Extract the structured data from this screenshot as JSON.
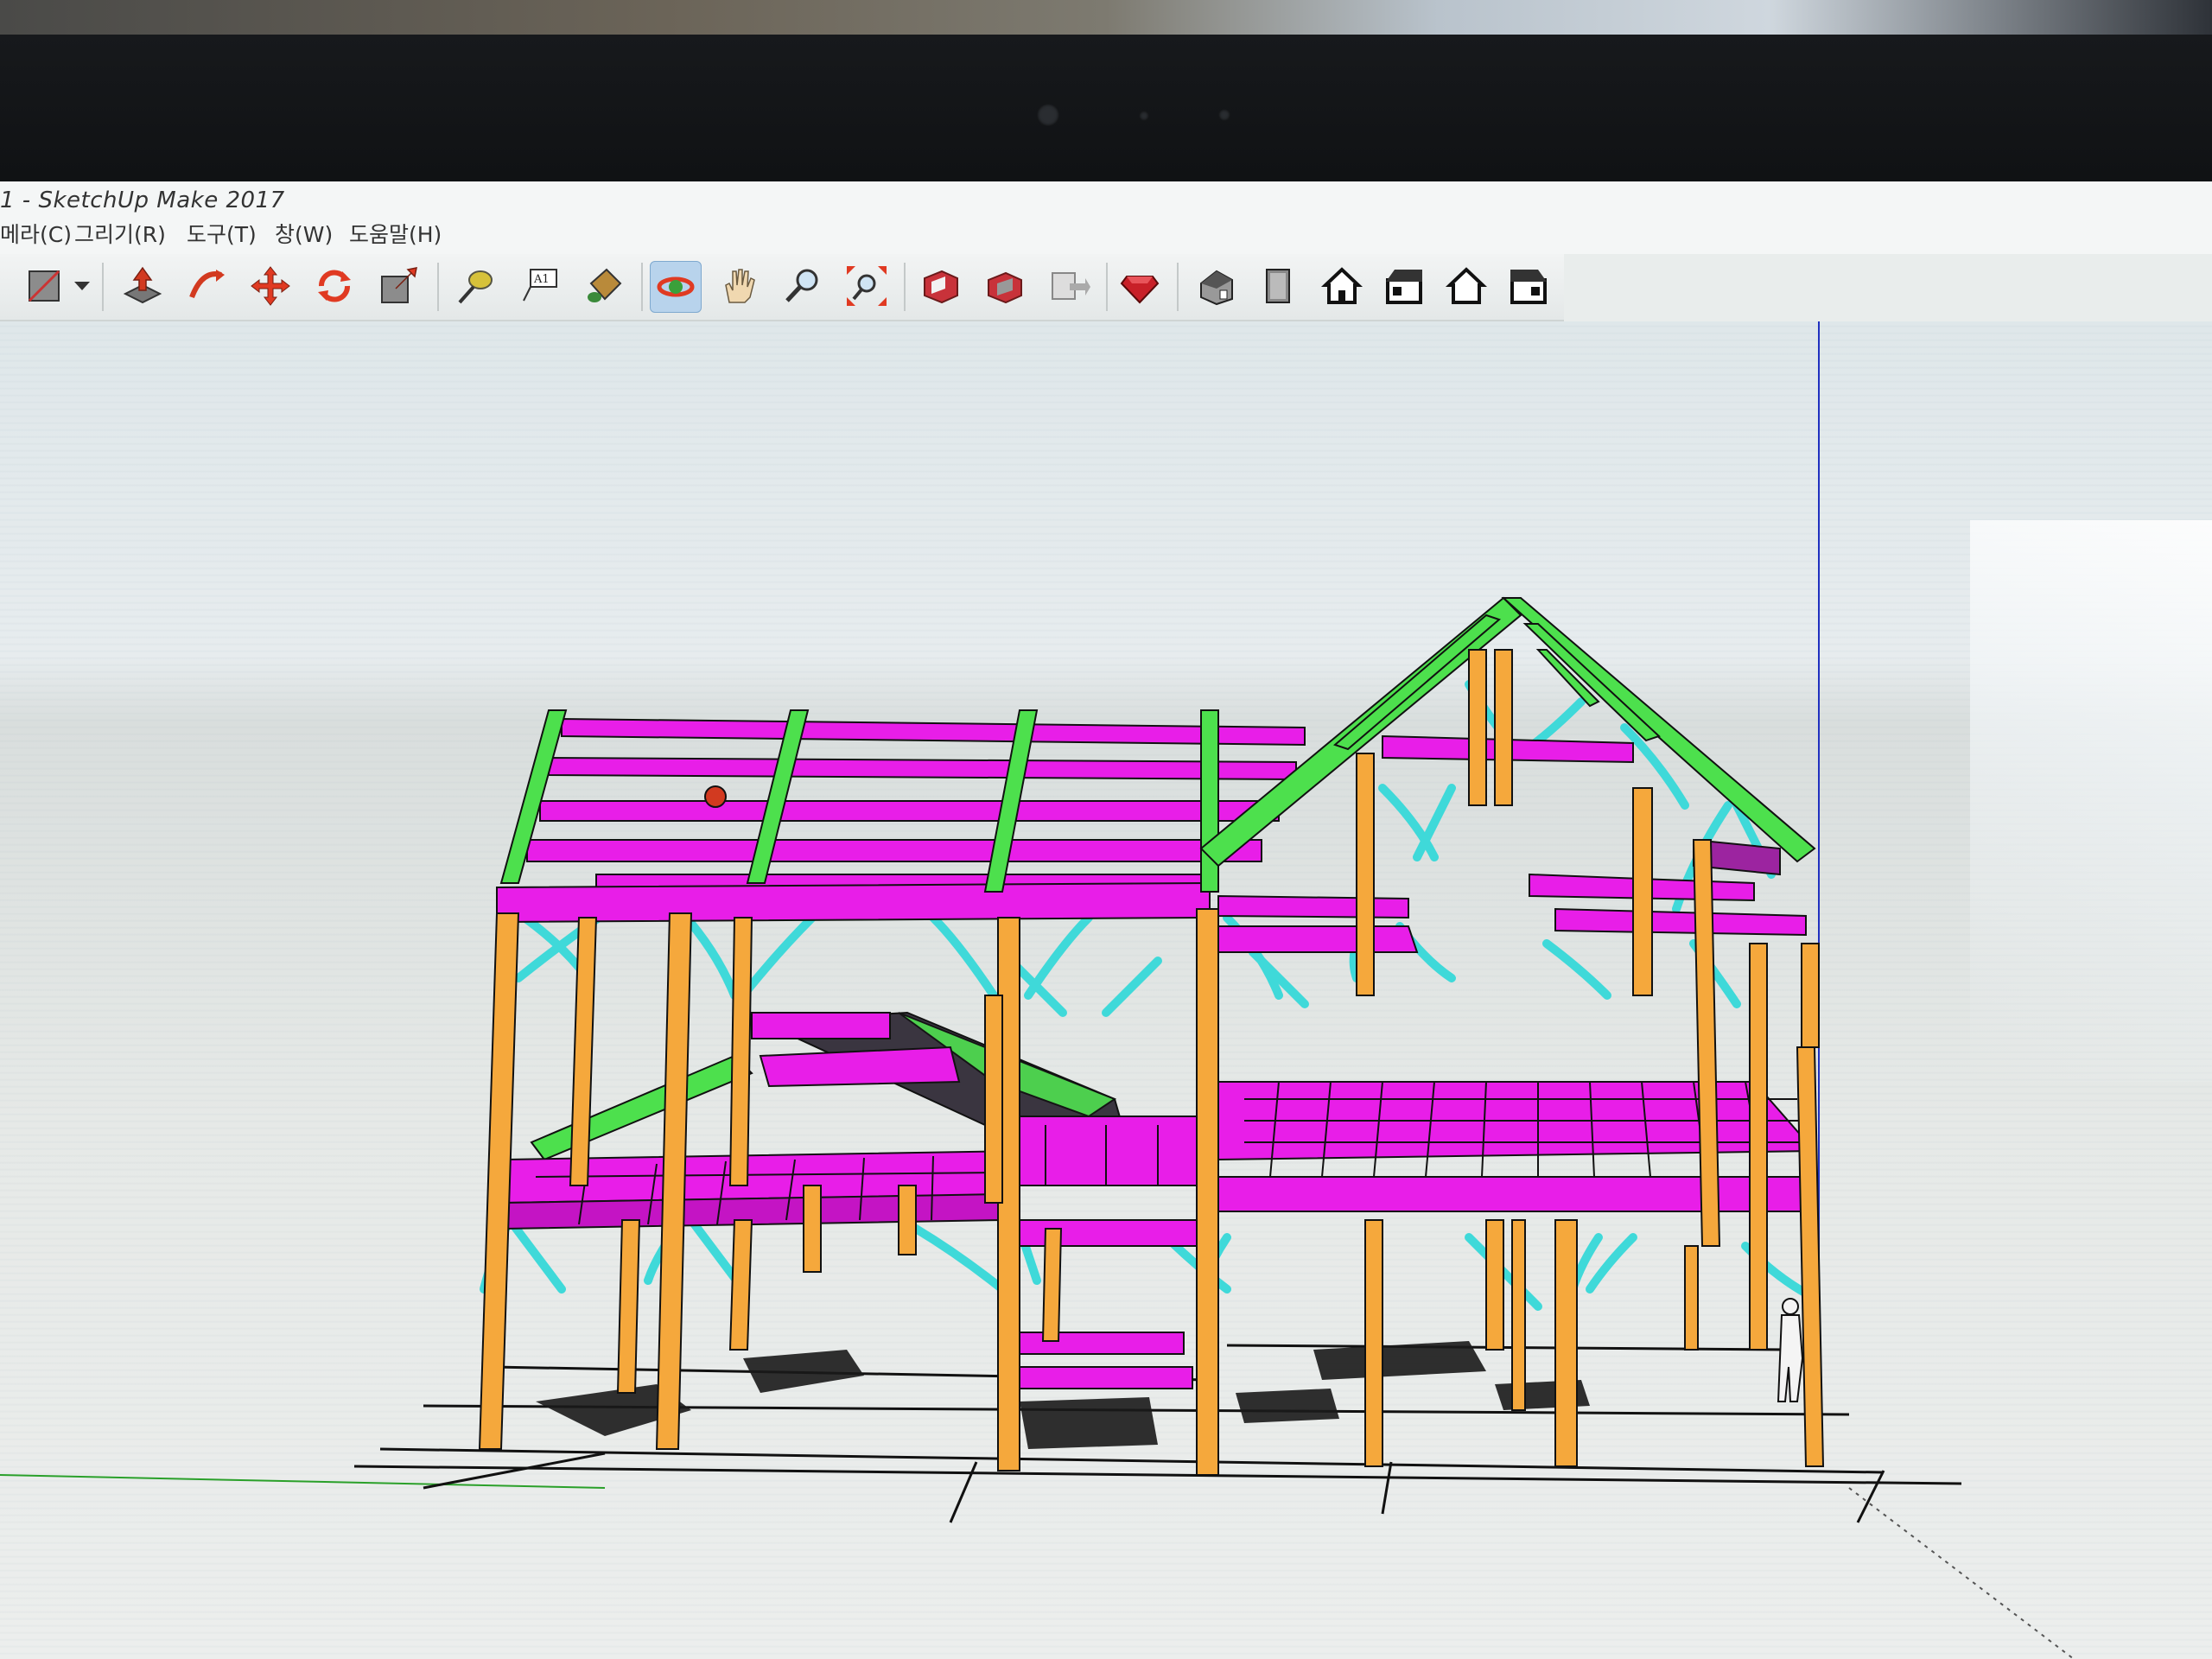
{
  "window": {
    "title": "1 - SketchUp Make 2017"
  },
  "menu": {
    "items": [
      {
        "label": "메라(C)"
      },
      {
        "label": "그리기(R)"
      },
      {
        "label": "도구(T)"
      },
      {
        "label": "창(W)"
      },
      {
        "label": "도움말(H)"
      }
    ]
  },
  "toolbar": {
    "tools": [
      {
        "icon": "rectangle-icon"
      },
      {
        "icon": "dropdown-arrow-icon"
      },
      {
        "icon": "push-pull-icon"
      },
      {
        "icon": "follow-me-icon"
      },
      {
        "icon": "move-icon"
      },
      {
        "icon": "rotate-icon"
      },
      {
        "icon": "scale-icon"
      },
      {
        "icon": "tape-measure-icon"
      },
      {
        "icon": "text-label-icon"
      },
      {
        "icon": "paint-bucket-icon"
      },
      {
        "icon": "orbit-icon",
        "active": true
      },
      {
        "icon": "pan-hand-icon"
      },
      {
        "icon": "zoom-icon"
      },
      {
        "icon": "zoom-extents-icon"
      },
      {
        "icon": "3d-warehouse-icon"
      },
      {
        "icon": "share-model-icon"
      },
      {
        "icon": "extension-warehouse-icon"
      },
      {
        "icon": "ruby-extension-icon"
      },
      {
        "icon": "iso-view-icon"
      },
      {
        "icon": "top-view-icon"
      },
      {
        "icon": "front-view-icon"
      },
      {
        "icon": "right-view-icon"
      },
      {
        "icon": "back-view-icon"
      },
      {
        "icon": "left-view-icon"
      }
    ]
  },
  "colors": {
    "post": "#f5a83c",
    "beam": "#e81ee8",
    "rafter": "#4de04d",
    "brace": "#3fd9d9",
    "outline": "#1a1a1a"
  }
}
